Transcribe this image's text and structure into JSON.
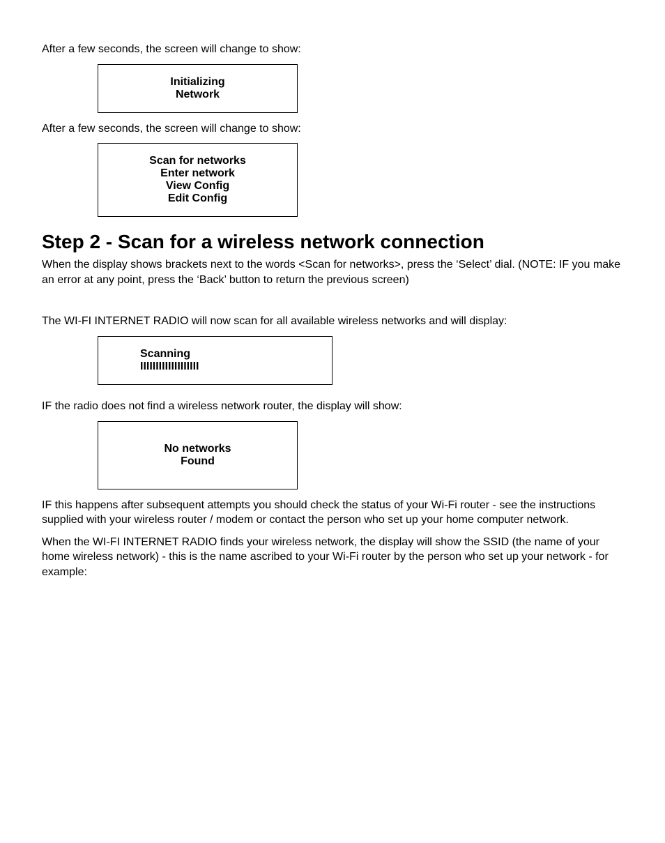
{
  "para1": "After a few seconds, the screen will change to show:",
  "screen1": {
    "line1": "Initializing",
    "line2": "Network"
  },
  "para2": "After a few seconds, the screen will change to show:",
  "screen2": {
    "line1": "Scan for networks",
    "line2": "Enter network",
    "line3": "View Config",
    "line4": "Edit Config"
  },
  "step_heading": "Step 2 - Scan for a wireless network connection",
  "para3": "When the display shows brackets next to the words <Scan for networks>, press the ‘Select’ dial. (NOTE:  IF you make an error at any point, press the ‘Back’ button to return the previous screen)",
  "para4": "The WI-FI INTERNET RADIO will now scan for all available wireless networks and will display:",
  "screen3": {
    "line1": "Scanning"
  },
  "para5": "IF the radio does not find a wireless network router, the display will show:",
  "screen4": {
    "line1": "No networks",
    "line2": "Found"
  },
  "para6": "IF this happens after subsequent attempts you should check the status of your Wi-Fi router - see the instructions supplied with your wireless router / modem or contact the person who set up your home computer network.",
  "para7": "When the WI-FI INTERNET RADIO finds your wireless network, the display will show the SSID (the name of your home wireless network) - this is the name ascribed to your Wi-Fi router by the person who set up your network - for example:"
}
